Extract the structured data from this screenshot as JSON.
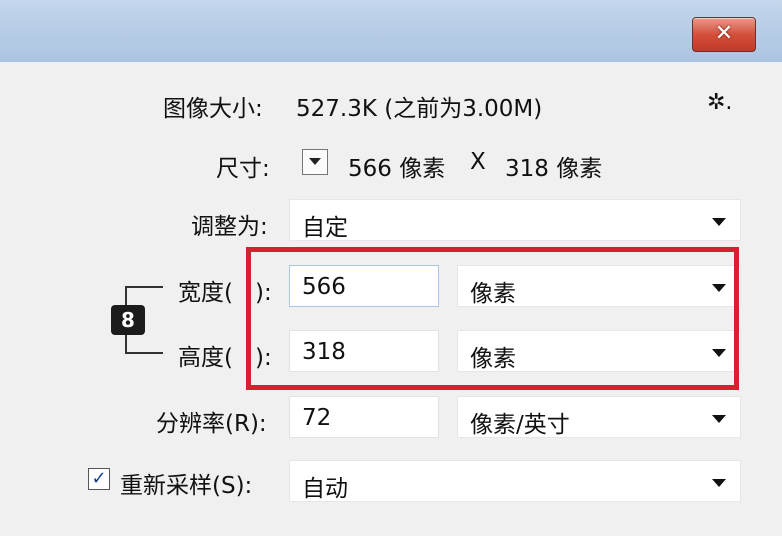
{
  "window": {
    "close_glyph": "✕"
  },
  "image_size": {
    "label": "图像大小:",
    "value": "527.3K (之前为3.00M)",
    "gear_glyph": "✲."
  },
  "dimensions": {
    "label": "尺寸:",
    "width_text": "566 像素",
    "x": "X",
    "height_text": "318 像素"
  },
  "fit_to": {
    "label": "调整为:",
    "value": "自定"
  },
  "width": {
    "label": "宽度(W):",
    "label_visible": "宽度(",
    "label_tail": "):",
    "value": "566",
    "unit": "像素"
  },
  "height": {
    "label": "高度(H):",
    "label_visible": "高度(",
    "label_tail": "):",
    "value": "318",
    "unit": "像素"
  },
  "resolution": {
    "label": "分辨率(R):",
    "value": "72",
    "unit": "像素/英寸"
  },
  "resample": {
    "checked": true,
    "check_glyph": "✓",
    "label": "重新采样(S):",
    "value": "自动"
  },
  "link_icon": {
    "glyph": "8"
  },
  "colors": {
    "highlight": "#d5202f",
    "close": "#c9412d"
  }
}
